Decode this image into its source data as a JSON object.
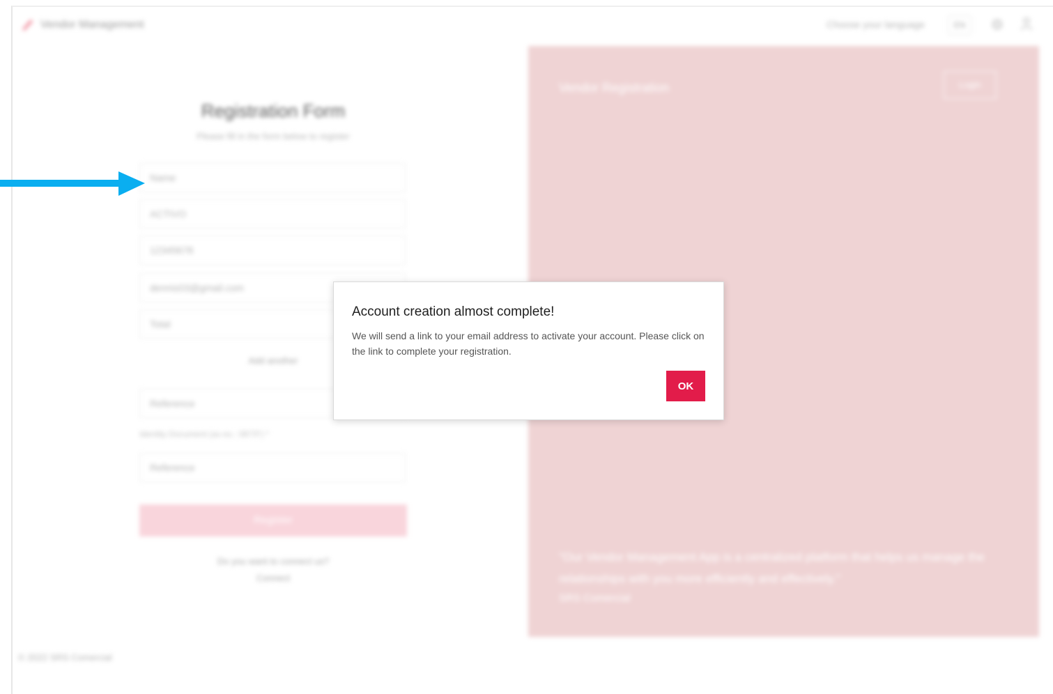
{
  "app": {
    "title": "Vendor Management",
    "language_label": "Choose your language",
    "language_value": "EN"
  },
  "form": {
    "title": "Registration Form",
    "subtitle": "Please fill in the form below to register",
    "fields": [
      {
        "value": "Name"
      },
      {
        "value": "ACTIVO"
      },
      {
        "value": "12345678"
      },
      {
        "value": "dennis03@gmail.com"
      },
      {
        "value": "Total"
      }
    ],
    "mid_link": "Add another",
    "extra_field_1": "Reference",
    "hint_text": "Identity Document (as ex.: 0873*) *",
    "extra_field_2": "Reference",
    "register_label": "Register",
    "signin_prompt": "Do you want to connect us?",
    "signin_link": "Connect"
  },
  "promo": {
    "title": "Vendor Registration",
    "login_label": "Login",
    "quote": "\"Our Vendor Management App is a centralized platform that helps us manage the relationships with you more efficiently and effectively.\"",
    "author": "SRS Comercial"
  },
  "footer": {
    "copyright": "© 2022 SRS Comercial"
  },
  "dialog": {
    "title": "Account creation almost complete!",
    "message": "We will send a link to your email address to activate your account. Please click on the link to complete your registration.",
    "ok_label": "OK"
  },
  "colors": {
    "accent": "#e21c4a",
    "promo_bg": "#efd3d4",
    "register_disabled": "#f9d5dc",
    "annotation_arrow": "#0aaef0"
  }
}
